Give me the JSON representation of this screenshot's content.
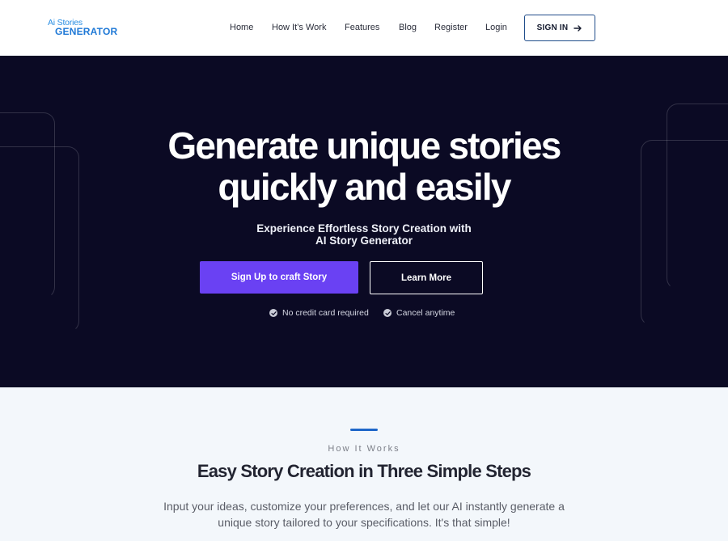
{
  "header": {
    "logo_top": "Ai Stories",
    "logo_bottom": "GENERATOR",
    "nav": {
      "home": "Home",
      "how": "How It’s Work",
      "features": "Features",
      "blog": "Blog",
      "register": "Register",
      "login": "Login"
    },
    "signin_label": "SIGN IN",
    "signin_icon": "arrow-right-icon"
  },
  "hero": {
    "title_line1": "Generate unique stories",
    "title_line2": "quickly and easily",
    "subtitle_line1": "Experience Effortless Story Creation with",
    "subtitle_line2": "AI Story Generator",
    "primary_cta": "Sign Up to craft Story",
    "secondary_cta": "Learn More",
    "note1": "No credit card required",
    "note2": "Cancel anytime",
    "note_icon": "check-circle-icon"
  },
  "how": {
    "eyebrow": "How It Works",
    "title": "Easy Story Creation in Three Simple Steps",
    "desc_line1": "Input your ideas, customize your preferences, and let our AI instantly generate a",
    "desc_line2": "unique story tailored to your specifications. It's that simple!"
  },
  "colors": {
    "hero_bg": "#0b0a24",
    "primary": "#6a41f3",
    "accent": "#1f67c9",
    "section_bg": "#f3f7fb"
  }
}
